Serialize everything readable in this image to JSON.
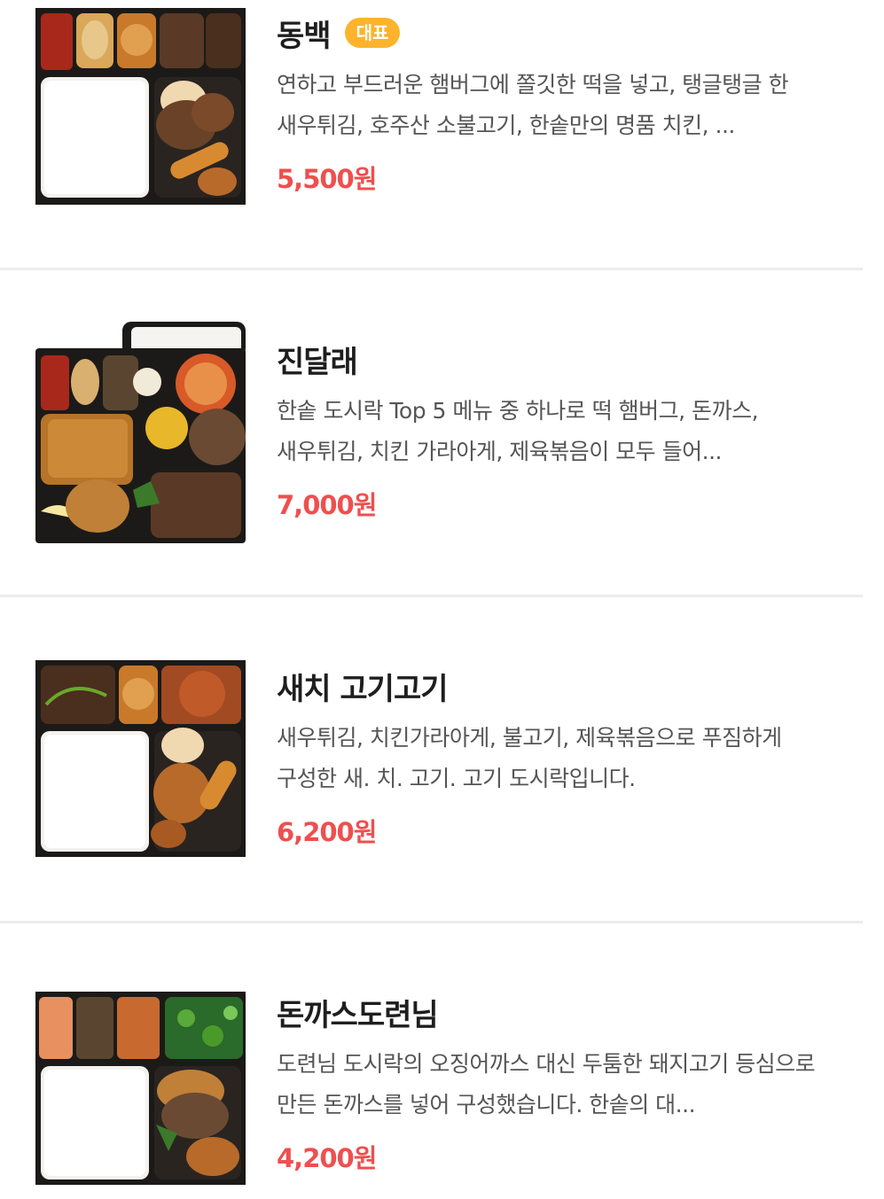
{
  "menu": {
    "items": [
      {
        "name": "동백",
        "badge": "대표",
        "description": "연하고 부드러운 햄버그에 쫄깃한 떡을 넣고, 탱글탱글 한 새우튀김, 호주산 소불고기, 한솥만의 명품 치킨, ...",
        "price": "5,500원",
        "image": "dongbaek-lunchbox-photo"
      },
      {
        "name": "진달래",
        "badge": "",
        "description": "한솥 도시락 Top 5 메뉴 중 하나로 떡 햄버그, 돈까스, 새우튀김, 치킨 가라아게, 제육볶음이 모두 들어...",
        "price": "7,000원",
        "image": "jindallae-lunchbox-photo"
      },
      {
        "name": "새치 고기고기",
        "badge": "",
        "description": "새우튀김, 치킨가라아게, 불고기, 제육볶음으로 푸짐하게 구성한 새. 치. 고기. 고기 도시락입니다.",
        "price": "6,200원",
        "image": "saechi-gogigogi-lunchbox-photo"
      },
      {
        "name": "돈까스도련님",
        "badge": "",
        "description": "도련님 도시락의 오징어까스 대신 두툼한 돼지고기 등심으로 만든 돈까스를 넣어 구성했습니다. 한솥의 대...",
        "price": "4,200원",
        "image": "donkkaseu-doryeonnim-lunchbox-photo"
      }
    ]
  },
  "colors": {
    "price": "#ef4f4f",
    "badge": "#fdb32c",
    "divider": "#ececec"
  }
}
